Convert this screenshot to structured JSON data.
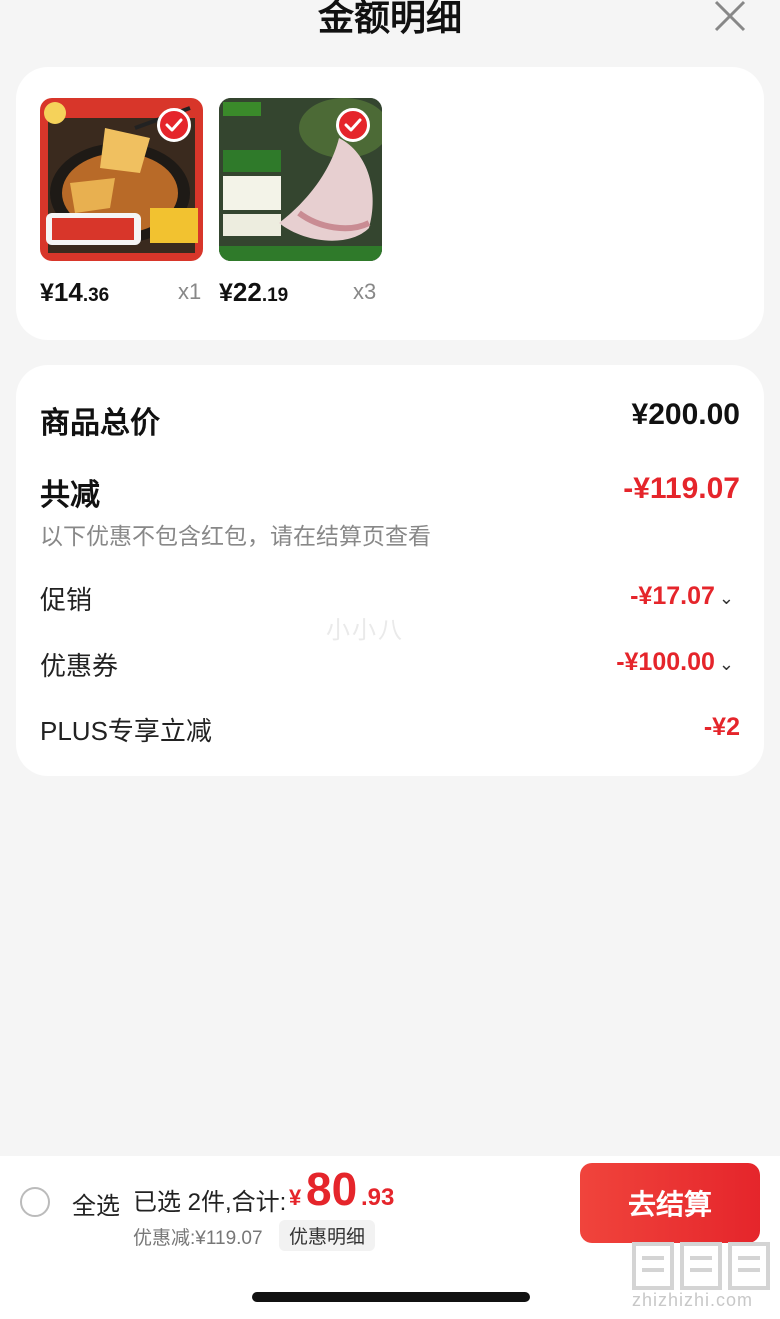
{
  "header": {
    "title": "金额明细"
  },
  "products": [
    {
      "price_int": "14",
      "price_dec": ".36",
      "yen": "¥",
      "qty": "x1",
      "selected": true
    },
    {
      "price_int": "22",
      "price_dec": ".19",
      "yen": "¥",
      "qty": "x3",
      "selected": true
    }
  ],
  "summary": {
    "goods_total_label": "商品总价",
    "goods_total_value": "¥200.00",
    "total_reduce_label": "共减",
    "total_reduce_value": "-¥119.07",
    "note": "以下优惠不包含红包，请在结算页查看",
    "promo_label": "促销",
    "promo_value": "-¥17.07",
    "coupon_label": "优惠券",
    "coupon_value": "-¥100.00",
    "plus_label": "PLUS专享立减",
    "plus_value": "-¥2"
  },
  "watermark_mid": "小小八",
  "bottom": {
    "select_all": "全选",
    "selected_text": "已选 2件,合计:",
    "total_yen": "¥",
    "total_int": "80",
    "total_dec": ".93",
    "discount_text": "优惠减:¥119.07",
    "detail_chip": "优惠明细",
    "checkout": "去结算"
  },
  "site": {
    "logo_text": "值值值",
    "url": "zhizhizhi.com"
  },
  "colors": {
    "accent_red": "#e5252b",
    "bg": "#f5f5f5"
  },
  "icons": [
    "close-icon",
    "check-icon",
    "radio-icon",
    "chevron-down-icon"
  ]
}
